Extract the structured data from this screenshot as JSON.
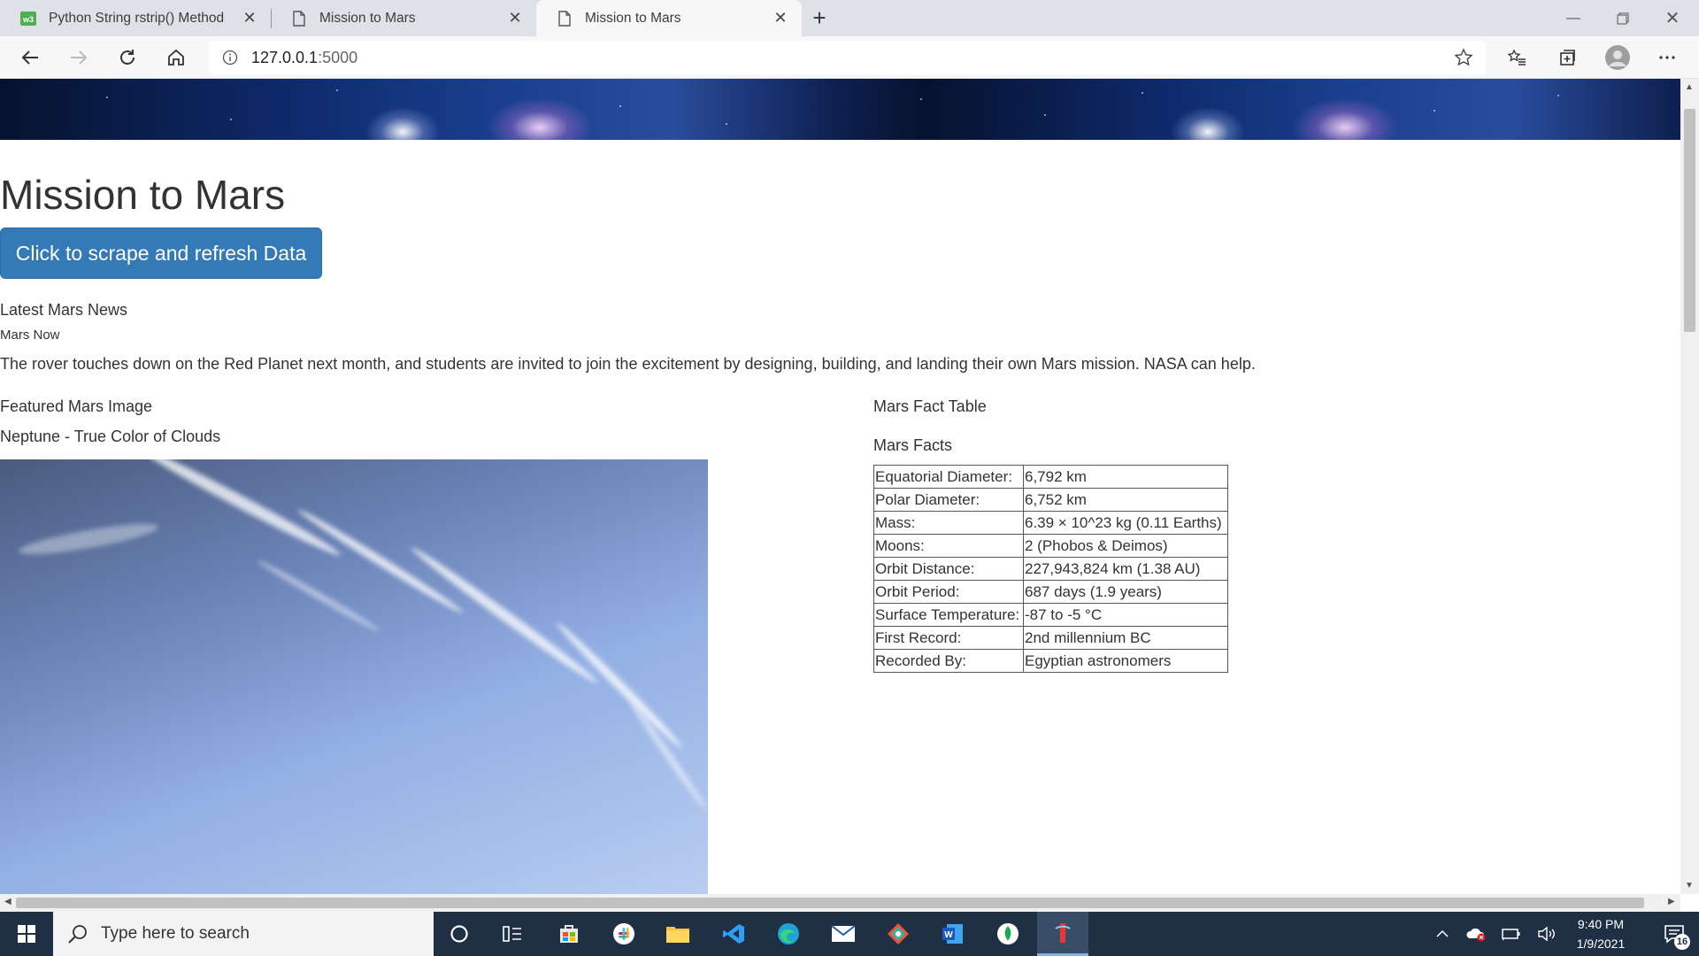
{
  "browser": {
    "tabs": [
      {
        "title": "Python String rstrip() Method",
        "icon": "w3schools-icon"
      },
      {
        "title": "Mission to Mars",
        "icon": "page-icon"
      },
      {
        "title": "Mission to Mars",
        "icon": "page-icon",
        "active": true
      }
    ],
    "url_host": "127.0.0.1",
    "url_port": ":5000"
  },
  "page": {
    "title": "Mission to Mars",
    "scrape_button": "Click to scrape and refresh Data",
    "news": {
      "heading": "Latest Mars News",
      "title": "Mars Now",
      "paragraph": "The rover touches down on the Red Planet next month, and students are invited to join the excitement by designing, building, and landing their own Mars mission. NASA can help."
    },
    "featured": {
      "heading": "Featured Mars Image",
      "caption": "Neptune - True Color of Clouds"
    },
    "facts": {
      "table_heading": "Mars Fact Table",
      "heading": "Mars Facts",
      "rows": [
        {
          "key": "Equatorial Diameter:",
          "value": "6,792 km"
        },
        {
          "key": "Polar Diameter:",
          "value": "6,752 km"
        },
        {
          "key": "Mass:",
          "value": "6.39 × 10^23 kg (0.11 Earths)"
        },
        {
          "key": "Moons:",
          "value": "2 (Phobos & Deimos)"
        },
        {
          "key": "Orbit Distance:",
          "value": "227,943,824 km (1.38 AU)"
        },
        {
          "key": "Orbit Period:",
          "value": "687 days (1.9 years)"
        },
        {
          "key": "Surface Temperature:",
          "value": "-87 to -5 °C"
        },
        {
          "key": "First Record:",
          "value": "2nd millennium BC"
        },
        {
          "key": "Recorded By:",
          "value": "Egyptian astronomers"
        }
      ]
    }
  },
  "taskbar": {
    "search_placeholder": "Type here to search",
    "time": "9:40 PM",
    "date": "1/9/2021",
    "notification_count": "16"
  }
}
